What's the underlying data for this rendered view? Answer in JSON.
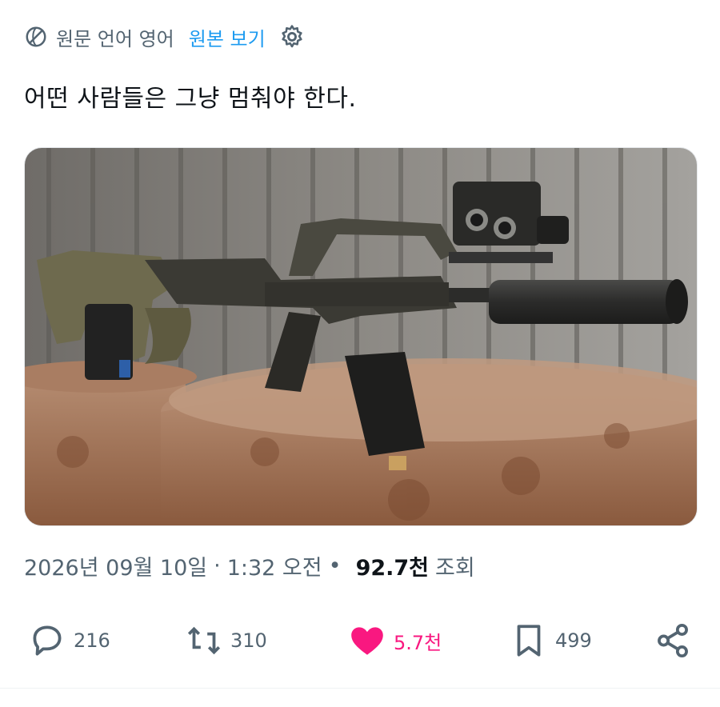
{
  "translate": {
    "source_label": "원문 언어 영어",
    "show_original": "원본 보기",
    "link_color": "#1d9bf0"
  },
  "post": {
    "text": "어떤 사람들은 그냥 멈춰야 한다.",
    "media_alt_icon": "rifle-photo"
  },
  "meta": {
    "date": "2026년 09월 10일",
    "time": "1:32 오전",
    "views_count": "92.7천",
    "views_label": "조회",
    "separator": "·"
  },
  "actions": {
    "replies": "216",
    "reposts": "310",
    "likes": "5.7천",
    "bookmarks": "499",
    "like_color": "#f91880"
  }
}
